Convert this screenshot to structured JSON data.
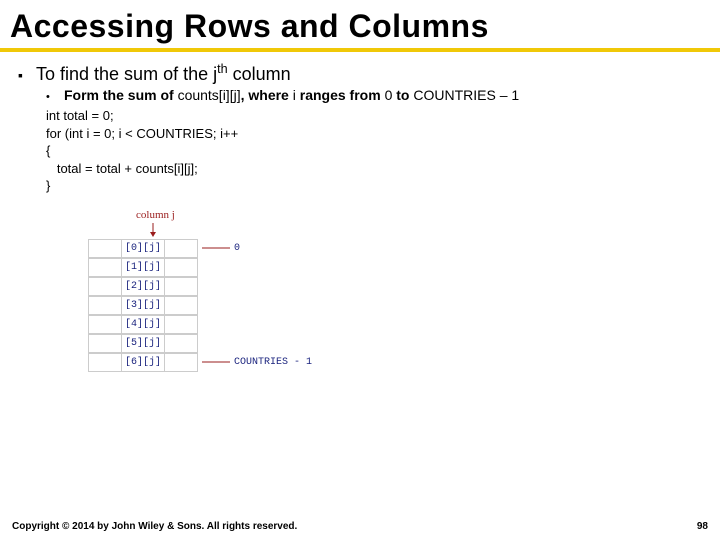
{
  "title": "Accessing Rows and Columns",
  "bullet1_prefix": "To find the sum of the ",
  "bullet1_var": "j",
  "bullet1_sup": "th",
  "bullet1_suffix": " column",
  "bullet2_prefix": "Form the sum of ",
  "bullet2_code": "counts[i][j]",
  "bullet2_mid": ", where ",
  "bullet2_var": "i",
  "bullet2_mid2": " ranges from ",
  "bullet2_zero": "0",
  "bullet2_to": " to ",
  "bullet2_end": "COUNTRIES – 1",
  "code": {
    "l1": "int total = 0;",
    "l2": "for (int i = 0; i < COUNTRIES; i++",
    "l3": "{",
    "l4": "   total = total + counts[i][j];",
    "l5": "}"
  },
  "diagram": {
    "col_label": "column   j",
    "cells": [
      "[0][j]",
      "[1][j]",
      "[2][j]",
      "[3][j]",
      "[4][j]",
      "[5][j]",
      "[6][j]"
    ],
    "annot_first": "0",
    "annot_last": "COUNTRIES - 1"
  },
  "footer": {
    "copyright": "Copyright © 2014 by John Wiley & Sons. All rights reserved.",
    "page": "98"
  }
}
